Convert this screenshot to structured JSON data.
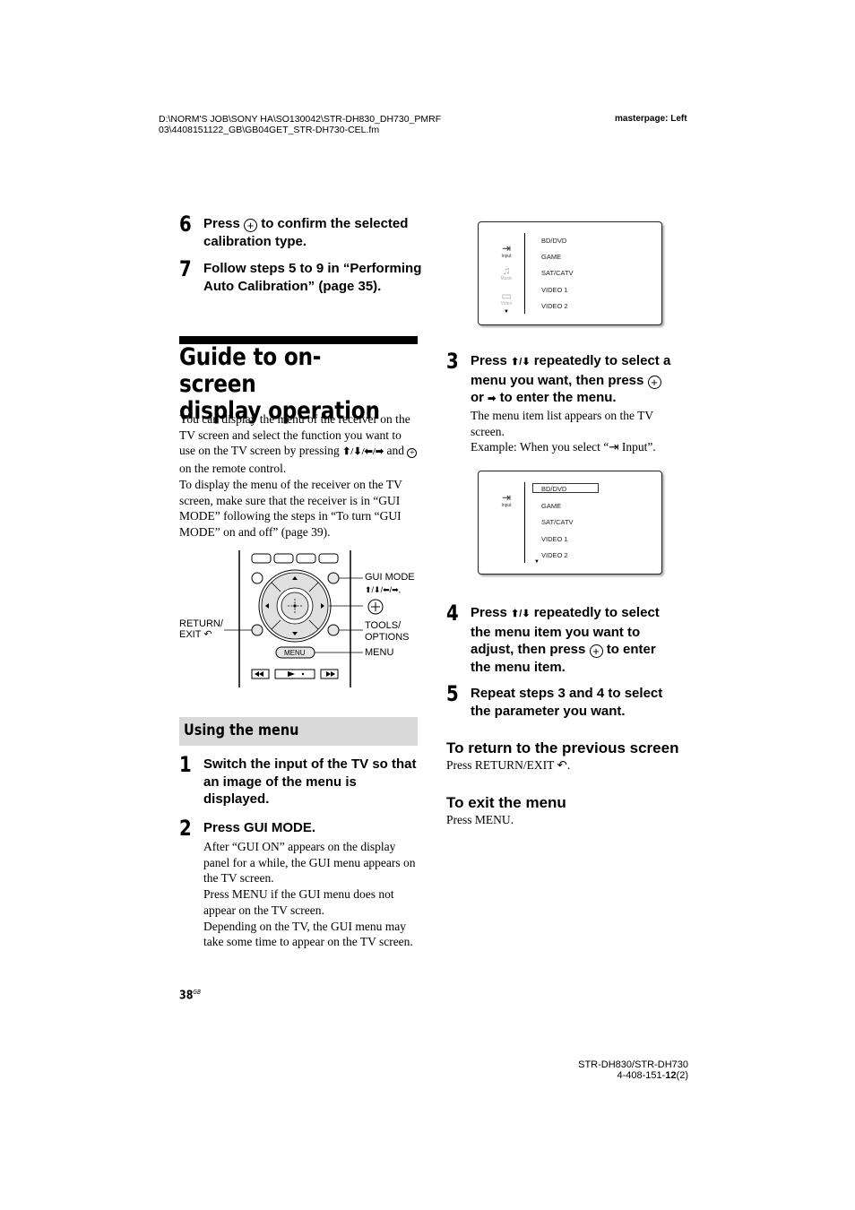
{
  "header": {
    "path_line1": "D:\\NORM'S JOB\\SONY HA\\SO130042\\STR-DH830_DH730_PMRF",
    "path_line2": "03\\4408151122_GB\\GB04GET_STR-DH730-CEL.fm",
    "masterpage": "masterpage: Left"
  },
  "steps_top": [
    {
      "num": "6",
      "pre": "Press",
      "icon": "enter-button-icon",
      "post": "to confirm the selected calibration type."
    },
    {
      "num": "7",
      "text": "Follow steps 5 to 9 in “Performing Auto Calibration” (page 35)."
    }
  ],
  "section": {
    "title_line1": "Guide to on-screen",
    "title_line2": "display operation",
    "intro_p1_a": "You can display the menu of the receiver on the TV screen and select the function you want to use on the TV screen by pressing",
    "intro_arrows": "⬆/⬇/⬅/➡",
    "intro_p1_b": "and",
    "intro_p1_c": "on the remote control.",
    "intro_p2": "To display the menu of the receiver on the TV screen, make sure that the receiver is in “GUI MODE” following the steps in “To turn “GUI MODE” on and off” (page 39)."
  },
  "remote_diagram": {
    "labels": {
      "gui_mode": "GUI MODE",
      "arrows": "⬆/⬇/⬅/➡,",
      "return_exit_1": "RETURN/",
      "return_exit_2": "EXIT",
      "tools_1": "TOOLS/",
      "tools_2": "OPTIONS",
      "menu": "MENU",
      "menu_button": "MENU"
    }
  },
  "using_menu": {
    "heading": "Using the menu",
    "steps": [
      {
        "num": "1",
        "text": "Switch the input of the TV so that an image of the menu is displayed."
      },
      {
        "num": "2",
        "text": "Press GUI MODE.",
        "body": "After “GUI ON” appears on the display panel for a while, the GUI menu appears on the TV screen.\nPress MENU if the GUI menu does not appear on the TV screen.\nDepending on the TV, the GUI menu may take some time to appear on the TV screen."
      }
    ]
  },
  "tv_screen_1": {
    "categories": [
      "Input",
      "Music",
      "Video"
    ],
    "items": [
      "BD/DVD",
      "GAME",
      "SAT/CATV",
      "VIDEO 1",
      "VIDEO 2"
    ]
  },
  "step3": {
    "num": "3",
    "line1_pre": "Press",
    "line1_arrows": "⬆/⬇",
    "line1_post": "repeatedly to select a",
    "line2": "menu you want, then press",
    "line3_pre": "or",
    "line3_arrow": "➡",
    "line3_post": "to enter the menu.",
    "body1": "The menu item list appears on the TV screen.",
    "body2_pre": "Example: When you select “",
    "body2_post": " Input”."
  },
  "tv_screen_2": {
    "category": "Input",
    "items": [
      "BD/DVD",
      "GAME",
      "SAT/CATV",
      "VIDEO 1",
      "VIDEO 2"
    ],
    "selected": "BD/DVD"
  },
  "step4": {
    "num": "4",
    "line1_pre": "Press",
    "line1_arrows": "⬆/⬇",
    "line1_post": "repeatedly to select",
    "line2": "the menu item you want to",
    "line3_pre": "adjust, then press",
    "line3_post": "to enter",
    "line4": "the menu item."
  },
  "step5": {
    "num": "5",
    "text": "Repeat steps 3 and 4 to select the parameter you want."
  },
  "return_section": {
    "heading": "To return to the previous screen",
    "body": "Press RETURN/EXIT"
  },
  "exit_section": {
    "heading": "To exit the menu",
    "body": "Press MENU."
  },
  "page_number": {
    "num": "38",
    "suffix": "GB"
  },
  "footer": {
    "model": "STR-DH830/STR-DH730",
    "code_pre": "4-408-151-",
    "code_bold": "12",
    "code_post": "(2)"
  }
}
